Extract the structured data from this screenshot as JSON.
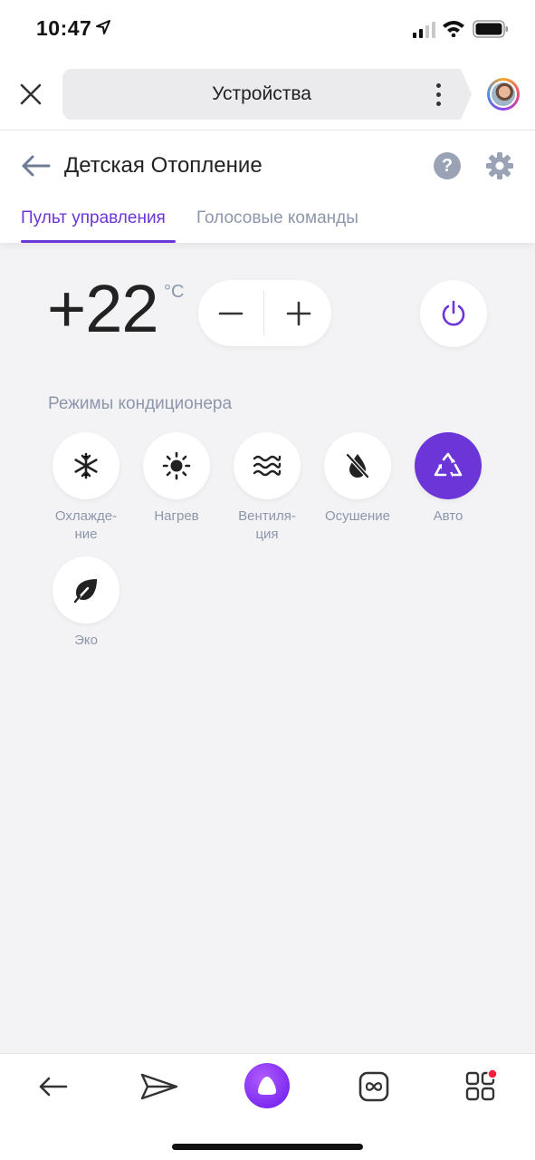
{
  "status_bar": {
    "time": "10:47"
  },
  "browser": {
    "title": "Устройства"
  },
  "header": {
    "title": "Детская Отопление",
    "tabs": [
      {
        "label": "Пульт управления",
        "active": true
      },
      {
        "label": "Голосовые команды",
        "active": false
      }
    ]
  },
  "control": {
    "temperature": "+22",
    "unit": "°C",
    "minus_label": "−",
    "plus_label": "+"
  },
  "modes": {
    "title": "Режимы кондиционера",
    "items": [
      {
        "label": "Охлажде-\nние",
        "icon": "snowflake-icon",
        "active": false
      },
      {
        "label": "Нагрев",
        "icon": "sun-icon",
        "active": false
      },
      {
        "label": "Вентиля-\nция",
        "icon": "wind-waves-icon",
        "active": false
      },
      {
        "label": "Осушение",
        "icon": "drop-icon",
        "active": false
      },
      {
        "label": "Авто",
        "icon": "recycle-triangle-icon",
        "active": true
      },
      {
        "label": "Эко",
        "icon": "leaf-icon",
        "active": false
      }
    ]
  },
  "colors": {
    "accent": "#6b35d7",
    "muted": "#8d97ab",
    "background": "#f3f3f5"
  },
  "bottom_nav": {
    "items": [
      "back-arrow-icon",
      "paper-plane-icon",
      "alice-icon",
      "infinity-icon",
      "apps-grid-icon"
    ],
    "apps_has_notification": true
  }
}
